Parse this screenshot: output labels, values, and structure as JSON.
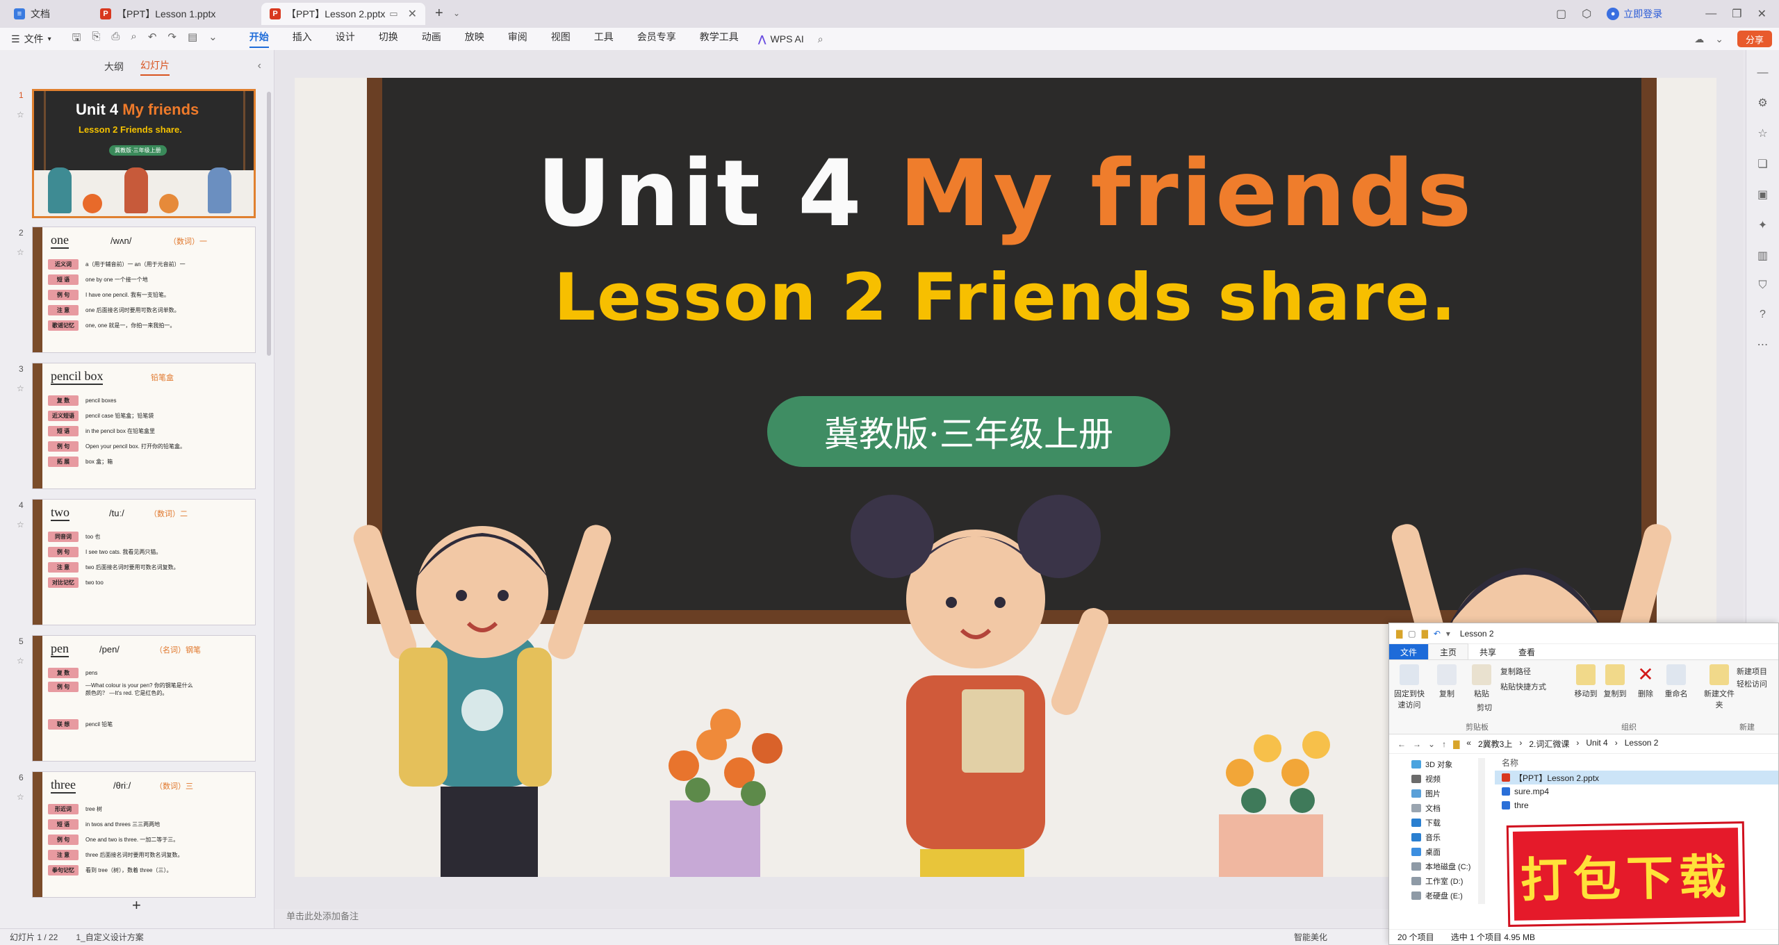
{
  "tabs": [
    {
      "label": "文档",
      "icon": "doc-icon"
    },
    {
      "label": "【PPT】Lesson 1.pptx",
      "icon": "ppt-icon"
    },
    {
      "label": "【PPT】Lesson 2.pptx",
      "icon": "ppt-icon",
      "active": true
    }
  ],
  "titlebar": {
    "login": "立即登录"
  },
  "ribbon": {
    "file_label": "文件",
    "menu": [
      "开始",
      "插入",
      "设计",
      "切换",
      "动画",
      "放映",
      "审阅",
      "视图",
      "工具",
      "会员专享",
      "教学工具"
    ],
    "active_menu": "开始",
    "wps_ai": "WPS AI",
    "share": "分享"
  },
  "left_panel": {
    "tab_outline": "大纲",
    "tab_slides": "幻灯片",
    "slides": [
      {
        "num": "1",
        "title_white": "Unit 4",
        "title_orange": "My friends",
        "subtitle": "Lesson 2 Friends share.",
        "badge": "冀教版·三年级上册"
      },
      {
        "num": "2",
        "word": "one",
        "phonetic": "/wʌn/",
        "meaning": "（数词）一",
        "rows": [
          [
            "近义词",
            "a（用于辅音前）一  an（用于元音前）一"
          ],
          [
            "短 语",
            "one by one 一个接一个地"
          ],
          [
            "例 句",
            "I have one pencil. 我有一支铅笔。"
          ],
          [
            "注 意",
            "one 后面接名词时要用可数名词单数。"
          ],
          [
            "歌谣记忆",
            "one, one 就是一，你拍一来我拍一。"
          ]
        ]
      },
      {
        "num": "3",
        "word": "pencil box",
        "phonetic": "",
        "meaning": "铅笔盒",
        "rows": [
          [
            "复 数",
            "pencil boxes"
          ],
          [
            "近义短语",
            "pencil case 铅笔盒；铅笔袋"
          ],
          [
            "短 语",
            "in the pencil box 在铅笔盒里"
          ],
          [
            "例 句",
            "Open your pencil box. 打开你的铅笔盒。"
          ],
          [
            "拓 展",
            "box 盒；箱"
          ]
        ]
      },
      {
        "num": "4",
        "word": "two",
        "phonetic": "/tuː/",
        "meaning": "（数词）二",
        "rows": [
          [
            "同音词",
            "too 也"
          ],
          [
            "例 句",
            "I see two cats. 我看见两只猫。"
          ],
          [
            "注 意",
            "two 后面接名词时要用可数名词复数。"
          ],
          [
            "对比记忆",
            "two  too"
          ]
        ]
      },
      {
        "num": "5",
        "word": "pen",
        "phonetic": "/pen/",
        "meaning": "（名词）钢笔",
        "rows": [
          [
            "复 数",
            "pens"
          ],
          [
            "例 句",
            "—What colour is your pen? 你的钢笔是什么颜色的？ —It's red. 它是红色的。"
          ],
          [
            "联 想",
            "pencil 铅笔"
          ]
        ]
      },
      {
        "num": "6",
        "word": "three",
        "phonetic": "/θriː/",
        "meaning": "（数词）三",
        "rows": [
          [
            "形近词",
            "tree 树"
          ],
          [
            "短 语",
            "in twos and threes 三三两两地"
          ],
          [
            "例 句",
            "One and two is three. 一加二等于三。"
          ],
          [
            "注 意",
            "three 后面接名词时要用可数名词复数。"
          ],
          [
            "拳句记忆",
            "看到 tree（树），数着 three（三）。"
          ]
        ]
      }
    ],
    "add_slide": "+"
  },
  "slide": {
    "title_white": "Unit 4",
    "title_orange": "My friends",
    "subtitle": "Lesson 2 Friends share.",
    "badge": "冀教版·三年级上册"
  },
  "notes_placeholder": "单击此处添加备注",
  "status": {
    "slide_pos": "幻灯片 1 / 22",
    "design": "1_自定义设计方案",
    "beautify": "智能美化"
  },
  "explorer": {
    "title": "Lesson 2",
    "tabs": [
      "文件",
      "主页",
      "共享",
      "查看"
    ],
    "ribbon_buttons": [
      "固定到快速访问",
      "复制",
      "粘贴",
      "移动到",
      "复制到",
      "删除",
      "重命名",
      "新建文件夹"
    ],
    "ribbon_small": [
      "复制路径",
      "粘贴快捷方式",
      "剪切",
      "新建项目",
      "轻松访问"
    ],
    "groups": [
      "剪贴板",
      "组织",
      "新建"
    ],
    "breadcrumbs": [
      "«",
      "2冀教3上",
      "2.词汇微课",
      "Unit 4",
      "Lesson 2"
    ],
    "nav": [
      "3D 对象",
      "视频",
      "图片",
      "文档",
      "下载",
      "音乐",
      "桌面",
      "本地磁盘 (C:)",
      "工作室 (D:)",
      "老硬盘 (E:)"
    ],
    "column_name": "名称",
    "files": [
      {
        "name": "【PPT】Lesson 2.pptx",
        "selected": true
      },
      {
        "name": "sure.mp4",
        "selected": false
      },
      {
        "name": "thre",
        "selected": false
      }
    ],
    "status_count": "20 个项目",
    "status_sel": "选中 1 个项目  4.95 MB"
  },
  "download_banner": "打包下载",
  "colors": {
    "accent": "#1d6bd9",
    "wps_orange": "#e85a2c",
    "board": "#2b2a29",
    "title_orange": "#ef7d2c",
    "subtitle_yellow": "#f7bf00",
    "pill_green": "#3f8d63"
  }
}
